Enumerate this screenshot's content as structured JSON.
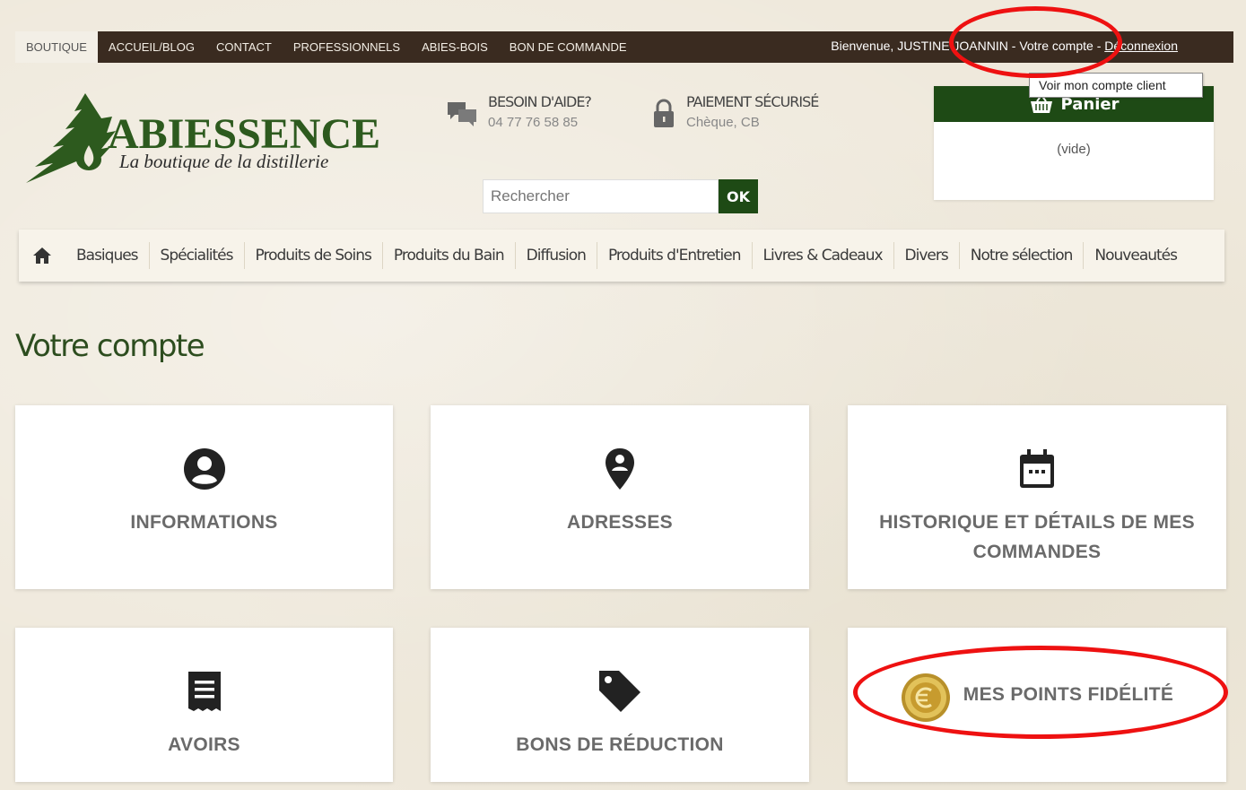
{
  "topnav": {
    "items": [
      "BOUTIQUE",
      "ACCUEIL/BLOG",
      "CONTACT",
      "PROFESSIONNELS",
      "ABIES-BOIS",
      "BON DE COMMANDE"
    ],
    "welcome": "Bienvenue, JUSTINE JOANNIN - ",
    "account_link": "Votre compte",
    "separator": " - ",
    "logout_link": "Déconnexion",
    "tooltip": "Voir mon compte client"
  },
  "header": {
    "brand": "ABIESSENCE",
    "tagline": "La boutique de la distillerie",
    "help_title": "BESOIN D'AIDE?",
    "help_phone": "04 77 76 58 85",
    "secure_title": "PAIEMENT SÉCURISÉ",
    "secure_methods": "Chèque, CB",
    "search_placeholder": "Rechercher",
    "search_button": "OK",
    "cart_title": "Panier",
    "cart_empty": "(vide)"
  },
  "menu": [
    "Basiques",
    "Spécialités",
    "Produits de Soins",
    "Produits du Bain",
    "Diffusion",
    "Produits d'Entretien",
    "Livres & Cadeaux",
    "Divers",
    "Notre sélection",
    "Nouveautés"
  ],
  "page_title": "Votre compte",
  "tiles": {
    "informations": "INFORMATIONS",
    "adresses": "ADRESSES",
    "historique_1": "HISTORIQUE ET DÉTAILS DE MES",
    "historique_2": "COMMANDES",
    "avoirs": "AVOIRS",
    "bons": "BONS DE RÉDUCTION",
    "points": "MES POINTS FIDÉLITÉ"
  },
  "colors": {
    "brand_green": "#1e4a15",
    "topbar": "#3a2b20",
    "annotation_red": "#e11111"
  }
}
